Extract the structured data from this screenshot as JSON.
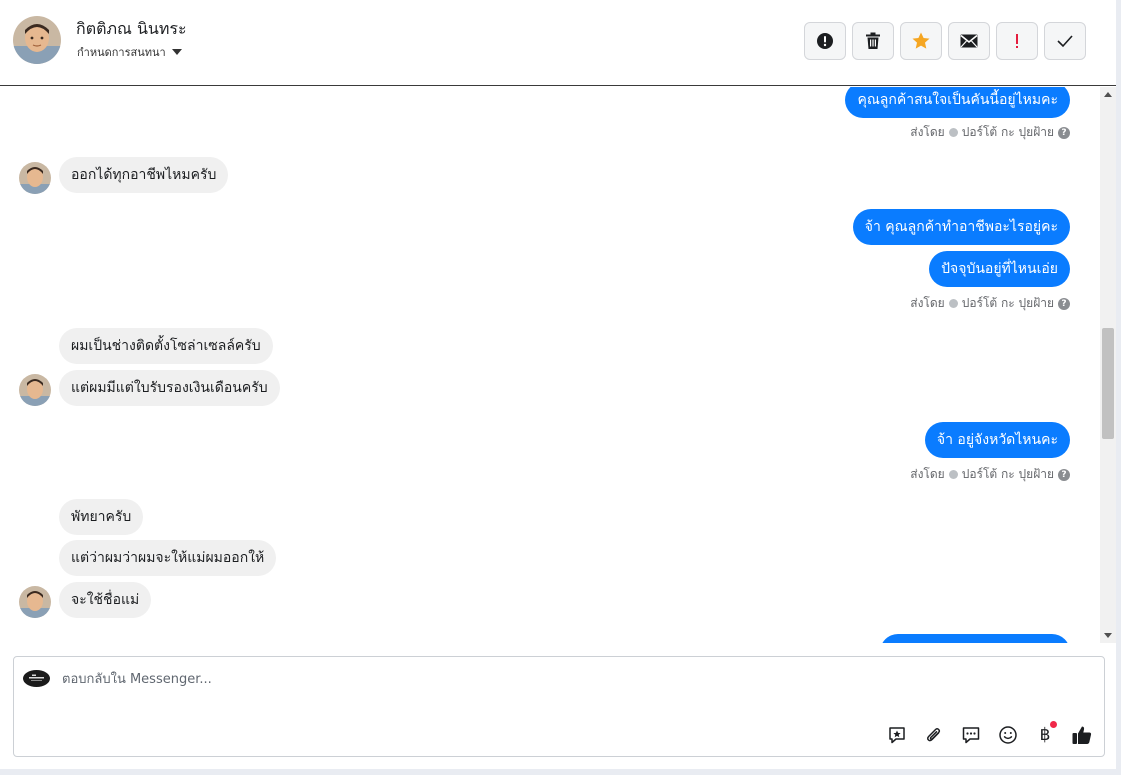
{
  "header": {
    "contact_name": "กิตติภณ นินทระ",
    "assign_label": "กำหนดการสนทนา",
    "toolbar": [
      {
        "name": "report-button",
        "icon": "exclamation-circle-icon"
      },
      {
        "name": "delete-button",
        "icon": "trash-icon"
      },
      {
        "name": "star-button",
        "icon": "star-icon",
        "color": "#f5a623"
      },
      {
        "name": "mail-button",
        "icon": "envelope-icon"
      },
      {
        "name": "important-button",
        "icon": "exclamation-icon",
        "color": "#e41e3f"
      },
      {
        "name": "done-button",
        "icon": "check-icon"
      }
    ]
  },
  "messages": {
    "m1": "คุณลูกค้าสนใจเป็นคันนี้อยู่ไหมคะ",
    "m2": "ออกได้ทุกอาชีพไหมครับ",
    "m3": "จ้า คุณลูกค้าทำอาชีพอะไรอยู่คะ",
    "m4": "ปัจจุบันอยู่ที่ไหนเอ่ย",
    "m5": "ผมเป็นช่างติดตั้งโซล่าเซลล์ครับ",
    "m6": "แต่ผมมีแต่ใบรับรองเงินเดือนครับ",
    "m7": "จ้า อยู่จังหวัดไหนคะ",
    "m8": "พัทยาครับ",
    "m9": "แต่ว่าผมว่าผมจะให้แม่ผมออกให้",
    "m10": "จะใช้ชื่อแม่"
  },
  "sent_by": {
    "prefix": "ส่งโดย",
    "agent": "ปอร์โต้ กะ ปุยฝ้าย",
    "help": "?"
  },
  "composer": {
    "placeholder": "ตอบกลับใน Messenger...",
    "tools": [
      "saved-reply-icon",
      "attachment-icon",
      "chat-bubble-icon",
      "emoji-icon",
      "baht-icon",
      "thumbs-up-icon"
    ],
    "baht_symbol": "฿"
  },
  "colors": {
    "outgoing_bubble": "#0a7cff",
    "incoming_bubble": "#f0f0f0"
  }
}
